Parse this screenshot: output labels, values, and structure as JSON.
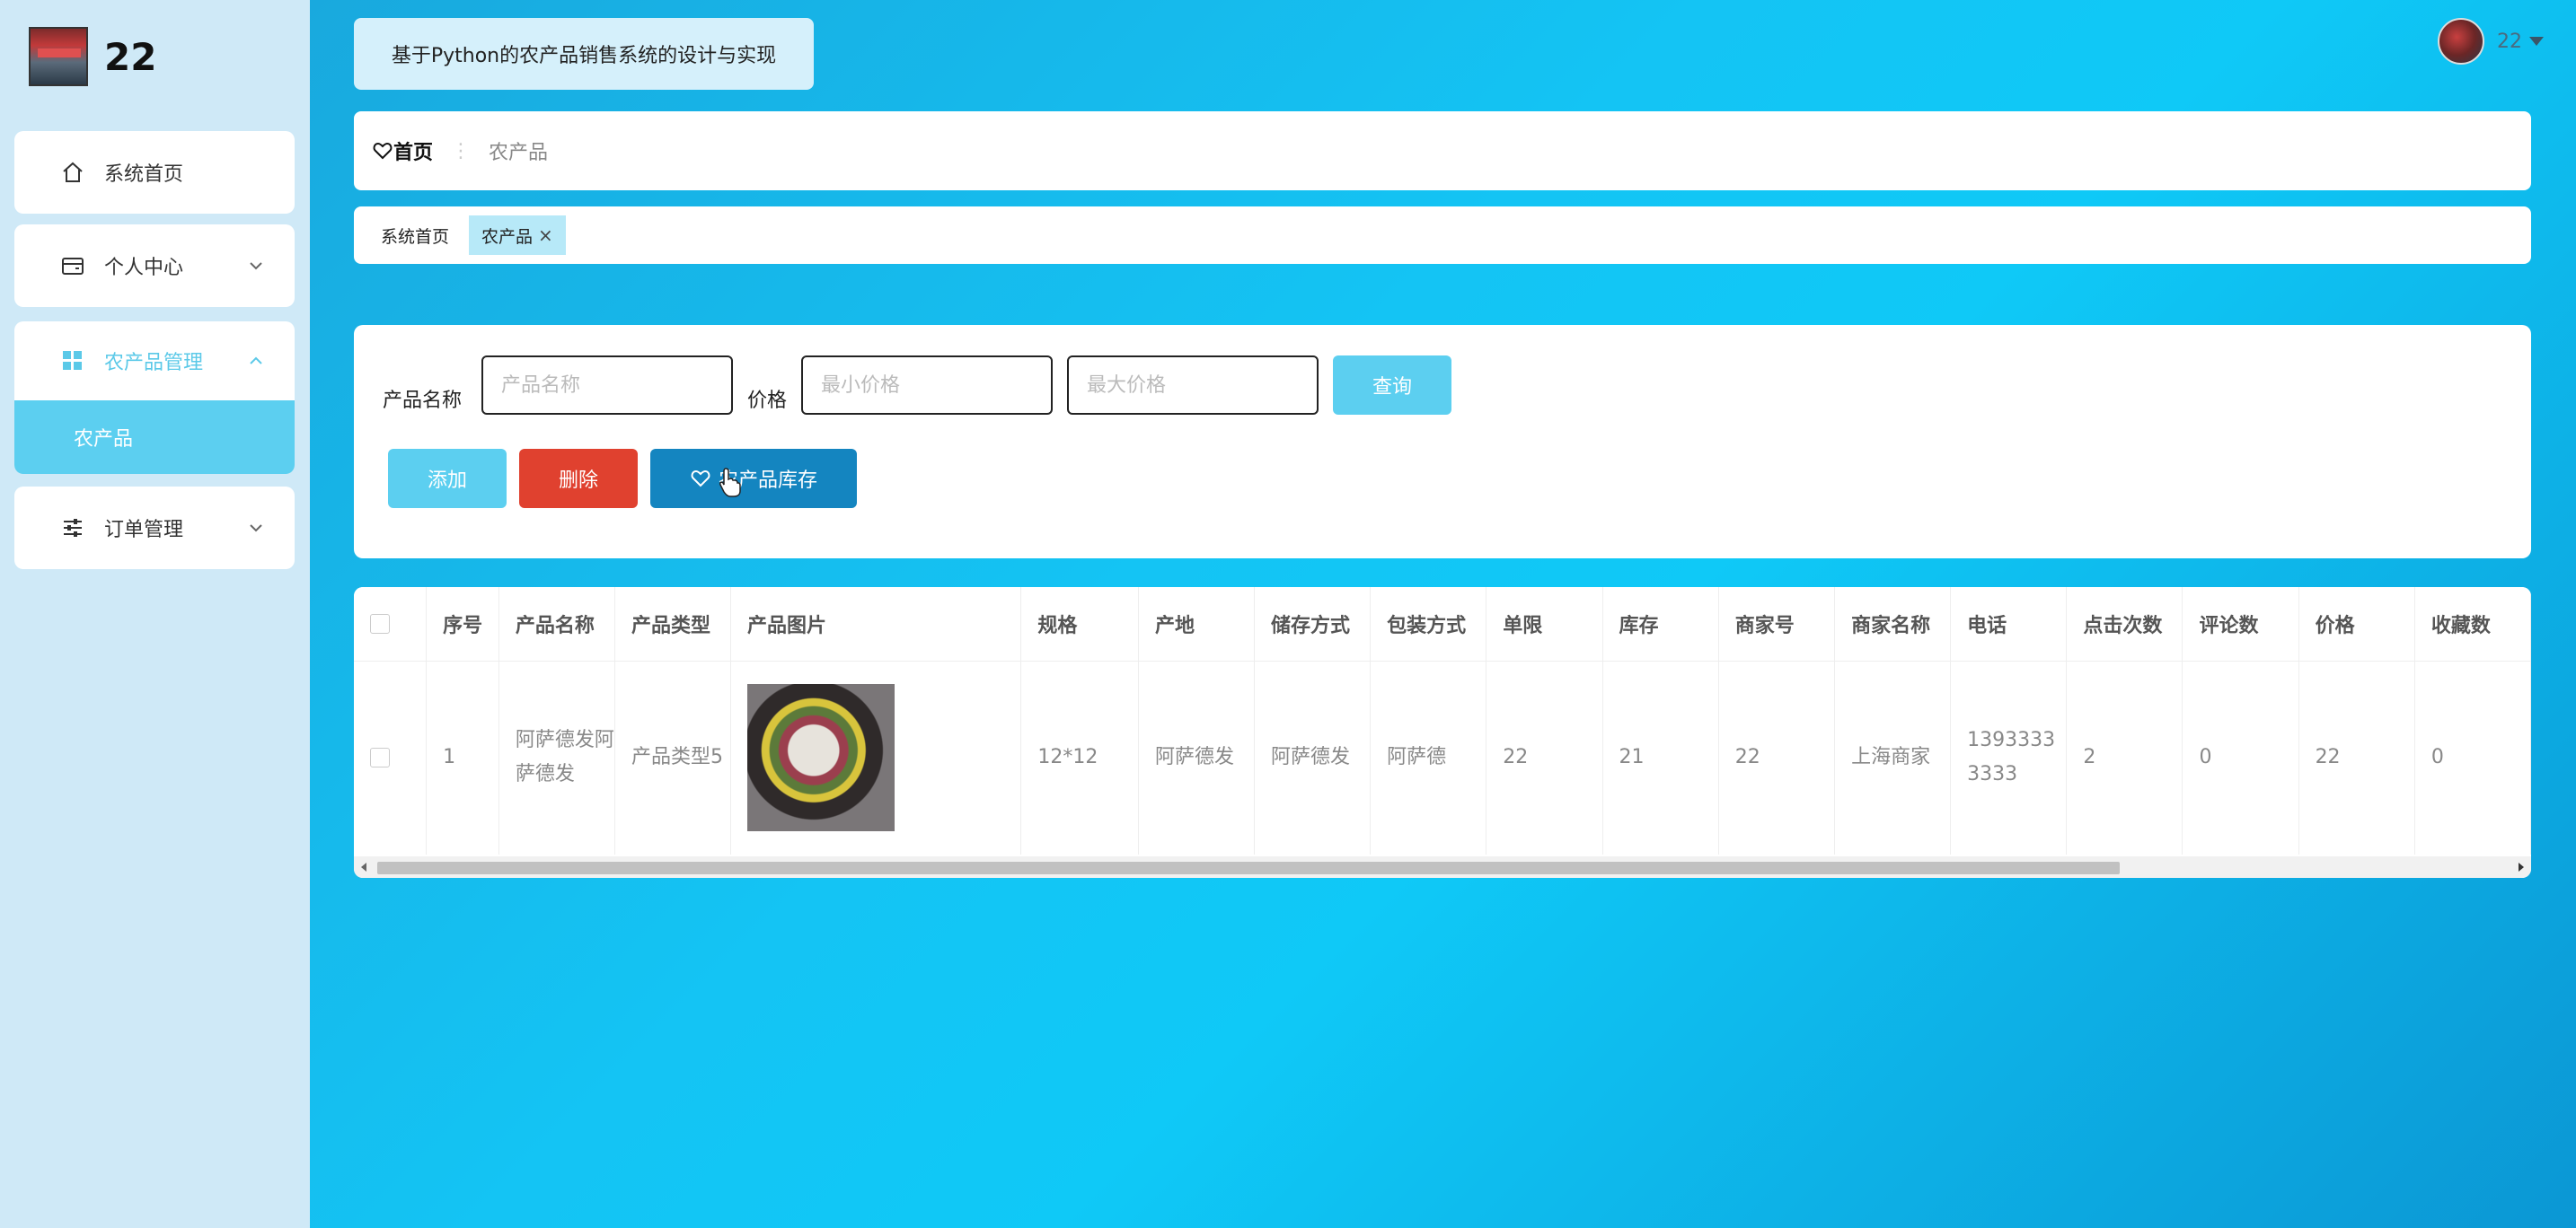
{
  "brand": {
    "title": "22"
  },
  "sidebar": {
    "items": [
      {
        "label": "系统首页",
        "icon": "home-icon"
      },
      {
        "label": "个人中心",
        "icon": "wallet-icon"
      },
      {
        "label": "农产品管理",
        "icon": "grid-icon",
        "children": [
          {
            "label": "农产品"
          }
        ]
      },
      {
        "label": "订单管理",
        "icon": "sliders-icon"
      }
    ]
  },
  "header": {
    "app_title": "基于Python的农产品销售系统的设计与实现",
    "user_name": "22"
  },
  "breadcrumb": {
    "home": "首页",
    "separator": "⋮",
    "current": "农产品"
  },
  "tabs": [
    {
      "label": "系统首页"
    },
    {
      "label": "农产品",
      "close": "×"
    }
  ],
  "filter": {
    "name_label": "产品名称",
    "name_placeholder": "产品名称",
    "price_label": "价格",
    "min_placeholder": "最小价格",
    "max_placeholder": "最大价格",
    "query_button": "查询"
  },
  "actions": {
    "add": "添加",
    "delete": "删除",
    "stock": "农产品库存"
  },
  "colors": {
    "accent": "#5ccff0",
    "danger": "#e0412f",
    "stock_button": "#1485c0",
    "sidebar_bg": "#cfe9f7"
  },
  "table": {
    "columns": [
      "序号",
      "产品名称",
      "产品类型",
      "产品图片",
      "规格",
      "产地",
      "储存方式",
      "包装方式",
      "单限",
      "库存",
      "商家号",
      "商家名称",
      "电话",
      "点击次数",
      "评论数",
      "价格",
      "收藏数"
    ],
    "rows": [
      {
        "index": "1",
        "name": "阿萨德发阿萨德发",
        "type": "产品类型5",
        "spec": "12*12",
        "origin": "阿萨德发",
        "storage": "阿萨德发",
        "packaging": "阿萨德",
        "limit": "22",
        "stock": "21",
        "merchant_no": "22",
        "merchant_name": "上海商家",
        "phone": "13933333333",
        "clicks": "2",
        "comments": "0",
        "price": "22",
        "favorites": "0"
      }
    ]
  }
}
